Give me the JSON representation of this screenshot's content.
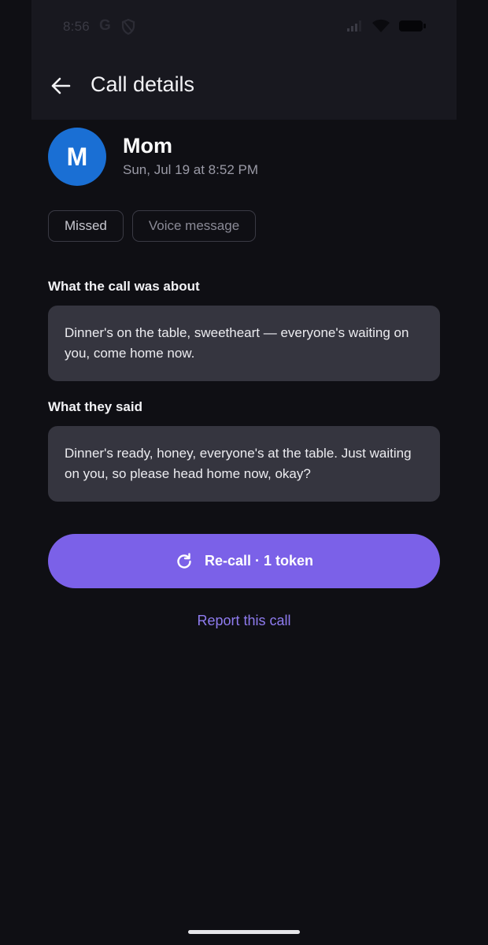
{
  "status_bar": {
    "time": "8:56",
    "google_glyph": "G",
    "icons": [
      "shield-icon",
      "signal-icon",
      "wifi-icon",
      "battery-icon"
    ]
  },
  "app_bar": {
    "title": "Call details",
    "back_icon": "arrow-left-icon"
  },
  "contact": {
    "initial": "M",
    "name": "Mom",
    "date": "Sun, Jul 19 at 8:52 PM",
    "avatar_color": "#1a6fd4"
  },
  "chips": [
    {
      "label": "Missed"
    },
    {
      "label": "Voice message"
    }
  ],
  "summary": {
    "label": "What the call was about",
    "text": "Dinner's on the table, sweetheart — everyone's waiting on you, come home now."
  },
  "transcript": {
    "label": "What they said",
    "text": "Dinner's ready, honey, everyone's at the table. Just waiting on you, so please head home now, okay?"
  },
  "actions": {
    "recall_label": "Re-call · 1 token",
    "recall_icon": "refresh-icon",
    "report_label": "Report this call"
  },
  "colors": {
    "accent": "#7b61e8",
    "link": "#8f7cf0",
    "background": "#0f0f14",
    "card": "#35353f"
  }
}
